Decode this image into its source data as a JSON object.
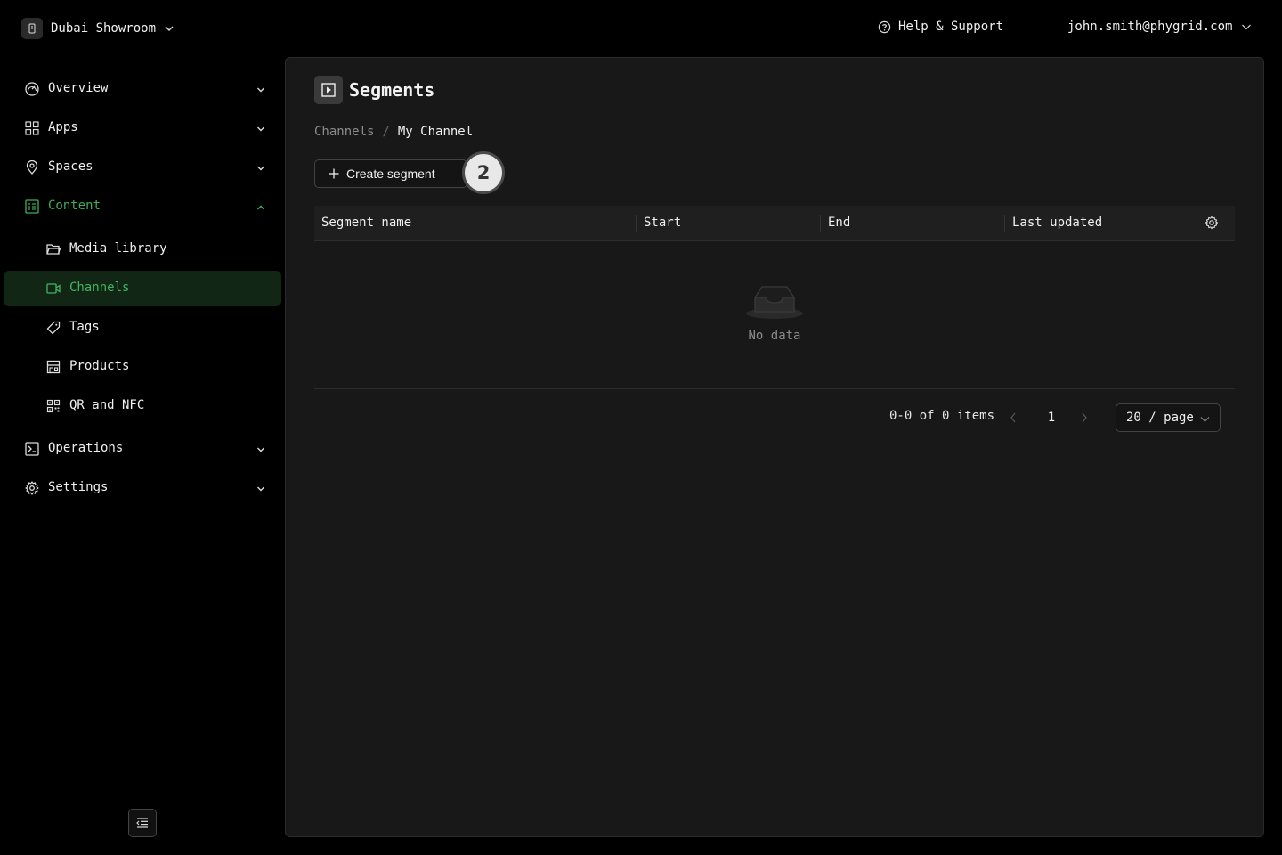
{
  "workspace": {
    "name": "Dubai Showroom"
  },
  "header": {
    "help_label": "Help & Support",
    "user_email": "john.smith@phygrid.com"
  },
  "sidebar": {
    "items": [
      {
        "label": "Overview",
        "icon": "gauge-icon"
      },
      {
        "label": "Apps",
        "icon": "grid-icon"
      },
      {
        "label": "Spaces",
        "icon": "map-pin-icon"
      },
      {
        "label": "Content",
        "icon": "content-icon",
        "expanded": true
      },
      {
        "label": "Operations",
        "icon": "terminal-icon"
      },
      {
        "label": "Settings",
        "icon": "gear-icon"
      }
    ],
    "content_children": [
      {
        "label": "Media library",
        "icon": "folder-icon"
      },
      {
        "label": "Channels",
        "icon": "video-icon",
        "active": true
      },
      {
        "label": "Tags",
        "icon": "tag-icon"
      },
      {
        "label": "Products",
        "icon": "store-icon"
      },
      {
        "label": "QR and NFC",
        "icon": "qr-code-icon"
      }
    ],
    "accent_color": "#44b35f"
  },
  "page": {
    "title": "Segments",
    "breadcrumb": {
      "parent": "Channels",
      "separator": "/",
      "current": "My Channel"
    },
    "create_button_label": "Create segment",
    "step_badge": "2"
  },
  "table": {
    "columns": [
      "Segment name",
      "Start",
      "End",
      "Last updated"
    ],
    "rows": [],
    "empty_text": "No data"
  },
  "pagination": {
    "total_text": "0-0 of 0 items",
    "current_page": "1",
    "page_size_label": "20 / page"
  }
}
